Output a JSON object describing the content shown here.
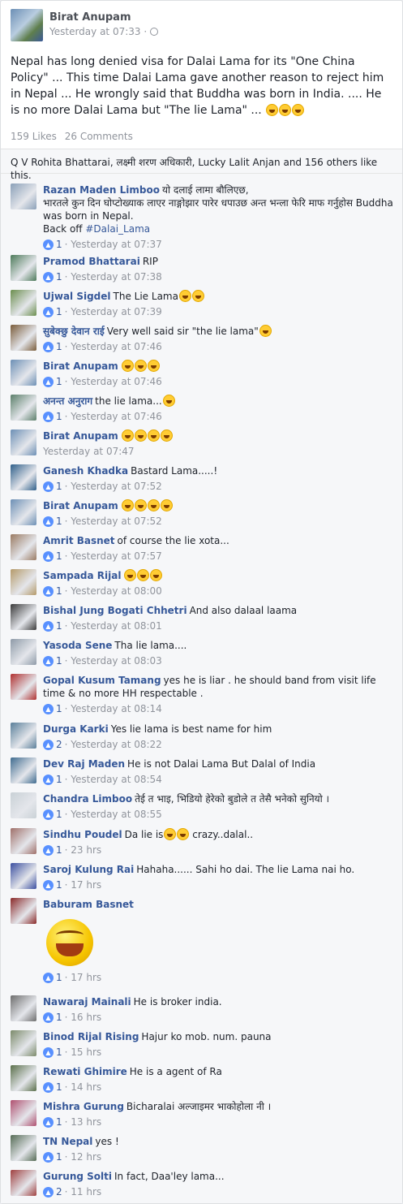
{
  "post": {
    "author": "Birat Anupam",
    "time": "Yesterday at 07:33 · ",
    "privacy_icon": "globe-icon",
    "text": "Nepal has long denied visa for Dalai Lama for its \"One China Policy\" ... This time Dalai Lama gave another reason to reject him in Nepal ... He wrongly said that Buddha was born in India. .... He is no more Dalai Lama but \"The lie Lama\" ...",
    "likes": "159 Likes",
    "comments": "26 Comments"
  },
  "likes_line": "Q V Rohita Bhattarai, लक्ष्मी शरण अधिकारी, Lucky Lalit Anjan and 156 others like this.",
  "comments": [
    {
      "name": "Razan Maden Limboo",
      "text": "यो दलाई लामा बौलिएछ,",
      "text2": "भारतले कुन दिन घोप्टोख्याक लाएर नाङ्गोझार पारेर धपाउछ अन्त भन्ला फेरि माफ गर्नुहोस Buddha was born in Nepal.",
      "text3": "Back off ",
      "hashtag": "#Dalai_Lama",
      "likes": "1",
      "time": "· Yesterday at 07:37",
      "color": "#8aa0b8"
    },
    {
      "name": "Pramod Bhattarai",
      "text": "RIP",
      "likes": "1",
      "time": "· Yesterday at 07:38",
      "color": "#4d7a5a"
    },
    {
      "name": "Ujwal Sigdel",
      "text": "The Lie Lama",
      "likes": "1",
      "time": "· Yesterday at 07:39",
      "color": "#6b8e4e"
    },
    {
      "name": "सुबेक्छु देवान राई",
      "text": "Very well said sir \"the lie lama\"",
      "likes": "1",
      "time": "· Yesterday at 07:46",
      "color": "#7a5c3a"
    },
    {
      "name": "Birat Anupam",
      "text": "",
      "likes": "1",
      "time": "· Yesterday at 07:46",
      "color": "#6c8fb5"
    },
    {
      "name": "अनन्त अनुराग",
      "text": "the lie lama...",
      "likes": "1",
      "time": "· Yesterday at 07:46",
      "color": "#5b7f6a"
    },
    {
      "name": "Birat Anupam",
      "text": "",
      "likes": "",
      "time": "Yesterday at 07:47",
      "color": "#6c8fb5"
    },
    {
      "name": "Ganesh Khadka",
      "text": "Bastard Lama.....!",
      "likes": "1",
      "time": "· Yesterday at 07:52",
      "color": "#2f5f8a"
    },
    {
      "name": "Birat Anupam",
      "text": "",
      "likes": "1",
      "time": "· Yesterday at 07:52",
      "color": "#6c8fb5"
    },
    {
      "name": "Amrit Basnet",
      "text": "of course the lie xota...",
      "likes": "1",
      "time": "· Yesterday at 07:57",
      "color": "#9a7a62"
    },
    {
      "name": "Sampada Rijal",
      "text": "",
      "likes": "1",
      "time": "· Yesterday at 08:00",
      "color": "#b59a6a"
    },
    {
      "name": "Bishal Jung Bogati Chhetri",
      "text": "And also dalaal laama",
      "likes": "1",
      "time": "· Yesterday at 08:01",
      "color": "#3a3a3a"
    },
    {
      "name": "Yasoda Sene",
      "text": "Tha lie lama....",
      "likes": "1",
      "time": "· Yesterday at 08:03",
      "color": "#8e9aa8"
    },
    {
      "name": "Gopal Kusum Tamang",
      "text": "yes he is liar . he should band from visit life time & no more HH respectable .",
      "likes": "1",
      "time": "· Yesterday at 08:14",
      "color": "#b03030"
    },
    {
      "name": "Durga Karki",
      "text": "Yes lie lama is best name for him",
      "likes": "2",
      "time": "· Yesterday at 08:22",
      "color": "#5a7f9a"
    },
    {
      "name": "Dev Raj Maden",
      "text": "He is not Dalai Lama But Dalal of India",
      "likes": "1",
      "time": "· Yesterday at 08:54",
      "color": "#3f6b8f"
    },
    {
      "name": "Chandra Limboo",
      "text": "तेई त भाइ, भिडियो हेरेको बुडोले त तेसै भनेको सुनियो ।",
      "likes": "1",
      "time": "· Yesterday at 08:55",
      "color": "#c9d1d6"
    },
    {
      "name": "Sindhu Poudel",
      "text": "Da lie is",
      "text_after": " crazy..dalal..",
      "likes": "1",
      "time": "· 23 hrs",
      "color": "#a0706a"
    },
    {
      "name": "Saroj Kulung Rai",
      "text": "Hahaha...... Sahi ho dai. The lie Lama nai ho.",
      "likes": "1",
      "time": "· 17 hrs",
      "color": "#3b4fa0"
    },
    {
      "name": "Baburam Basnet",
      "text": "",
      "likes": "1",
      "time": "· 17 hrs",
      "color": "#8a2a2a"
    },
    {
      "name": "Nawaraj Mainali",
      "text": "He is broker india.",
      "likes": "1",
      "time": "· 16 hrs",
      "color": "#6d6d6d"
    },
    {
      "name": "Binod Rijal Rising",
      "text": "Hajur ko mob. num. pauna",
      "likes": "1",
      "time": "· 15 hrs",
      "color": "#7b8a6a"
    },
    {
      "name": "Rewati Ghimire",
      "text": "He is a agent of Ra",
      "likes": "1",
      "time": "· 14 hrs",
      "color": "#5a6f4a"
    },
    {
      "name": "Mishra Gurung",
      "text": "Bicharalai अल्जाइमर भाकोहोला नी ।",
      "likes": "1",
      "time": "· 13 hrs",
      "color": "#b05070"
    },
    {
      "name": "TN Nepal",
      "text": "yes !",
      "likes": "1",
      "time": "· 12 hrs",
      "color": "#556b55"
    },
    {
      "name": "Gurung Solti",
      "text": "In fact, Daa'ley lama...",
      "likes": "2",
      "time": "· 11 hrs",
      "color": "#a04040"
    }
  ]
}
